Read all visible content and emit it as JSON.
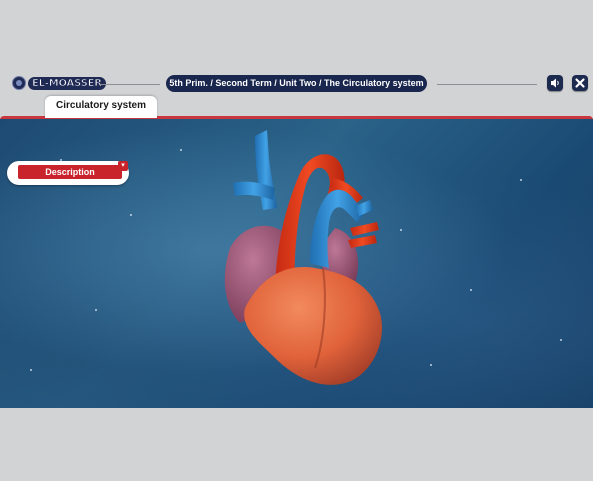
{
  "header": {
    "logo_text": "EL-MOASSER",
    "breadcrumb": "5th Prim. / Second Term / Unit Two / The Circulatory system",
    "sound_icon": "speaker-icon",
    "close_icon": "close-icon"
  },
  "tab": {
    "label": "Circulatory system"
  },
  "panel": {
    "description_label": "Description",
    "toggle_icon": "chevron-down-icon"
  },
  "content": {
    "image_subject": "heart-3d-model"
  },
  "colors": {
    "navy": "#19264d",
    "red_accent": "#c9242c",
    "background": "#d2d3d5",
    "stage_blue": "#1f4f78",
    "aorta_red": "#e4381c",
    "vein_blue": "#2f8fd4",
    "ventricle_orange": "#e66a3e",
    "atrium_purple": "#a25b7c"
  }
}
